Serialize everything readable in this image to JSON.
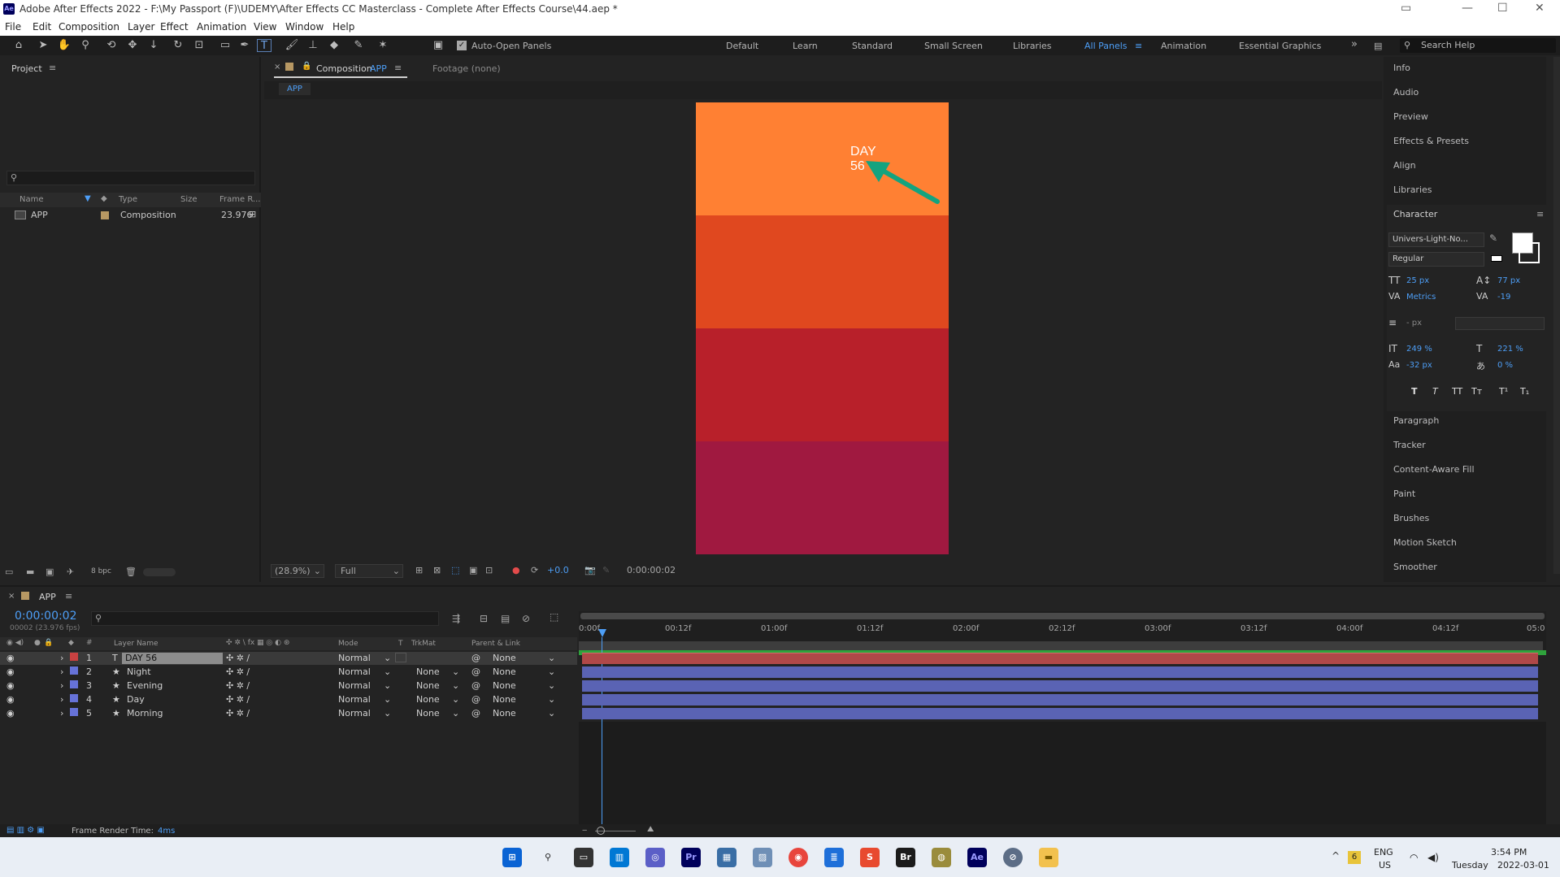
{
  "window": {
    "title": "Adobe After Effects 2022 - F:\\My Passport (F)\\UDEMY\\After Effects CC Masterclass - Complete After Effects Course\\44.aep *",
    "app_badge": "Ae",
    "controls": [
      "restore-panel-icon",
      "minimize-icon",
      "maximize-icon",
      "close-icon"
    ]
  },
  "menu": [
    "File",
    "Edit",
    "Composition",
    "Layer",
    "Effect",
    "Animation",
    "View",
    "Window",
    "Help"
  ],
  "toolbar": {
    "auto_open_panels": "Auto-Open Panels",
    "workspaces": [
      "Default",
      "Learn",
      "Standard",
      "Small Screen",
      "Libraries",
      "All Panels",
      "Animation",
      "Essential Graphics"
    ],
    "active_workspace": "All Panels",
    "more": "»",
    "search_placeholder": "Search Help"
  },
  "project": {
    "title": "Project",
    "columns": {
      "name": "Name",
      "type": "Type",
      "size": "Size",
      "frame_rate": "Frame R..."
    },
    "item": {
      "name": "APP",
      "type": "Composition",
      "frame_rate": "23.976"
    },
    "bpc": "8 bpc"
  },
  "composition": {
    "tab_label": "Composition",
    "tab_name": "APP",
    "footage": "Footage (none)",
    "breadcrumb": "APP",
    "canvas_text_line1": "DAY",
    "canvas_text_line2": "56",
    "zoom": "(28.9%)",
    "resolution": "Full",
    "exposure": "+0.0",
    "timecode": "0:00:00:02",
    "bands": [
      "#ff8033",
      "#e0481f",
      "#b8202a",
      "#a01940"
    ]
  },
  "right_panel": {
    "items_top": [
      "Info",
      "Audio",
      "Preview",
      "Effects & Presets",
      "Align",
      "Libraries"
    ],
    "character": {
      "title": "Character",
      "font": "Univers-Light-No...",
      "style": "Regular",
      "size": "25 px",
      "leading": "77 px",
      "kerning": "Metrics",
      "tracking": "-19",
      "stroke": "- px",
      "vscale": "249 %",
      "hscale": "221 %",
      "baseline": "-32 px",
      "tsume": "0 %",
      "format_buttons": [
        "T",
        "T",
        "TT",
        "Tт",
        "T¹",
        "T₁"
      ]
    },
    "items_bottom": [
      "Paragraph",
      "Tracker",
      "Content-Aware Fill",
      "Paint",
      "Brushes",
      "Motion Sketch",
      "Smoother"
    ]
  },
  "timeline": {
    "tab": "APP",
    "timecode": "0:00:00:02",
    "fps": "00002 (23.976 fps)",
    "columns": {
      "num": "#",
      "layer_name": "Layer Name",
      "mode": "Mode",
      "t": "T",
      "trkmat": "TrkMat",
      "parent": "Parent & Link"
    },
    "layers": [
      {
        "num": "1",
        "name": "DAY 56",
        "type": "T",
        "color": "#c94141",
        "mode": "Normal",
        "trkmat": "",
        "parent": "None"
      },
      {
        "num": "2",
        "name": "Night",
        "type": "★",
        "color": "#6672d8",
        "mode": "Normal",
        "trkmat": "None",
        "parent": "None"
      },
      {
        "num": "3",
        "name": "Evening",
        "type": "★",
        "color": "#6672d8",
        "mode": "Normal",
        "trkmat": "None",
        "parent": "None"
      },
      {
        "num": "4",
        "name": "Day",
        "type": "★",
        "color": "#6672d8",
        "mode": "Normal",
        "trkmat": "None",
        "parent": "None"
      },
      {
        "num": "5",
        "name": "Morning",
        "type": "★",
        "color": "#6672d8",
        "mode": "Normal",
        "trkmat": "None",
        "parent": "None"
      }
    ],
    "ruler": [
      "0:00f",
      "00:12f",
      "01:00f",
      "01:12f",
      "02:00f",
      "02:12f",
      "03:00f",
      "03:12f",
      "04:00f",
      "04:12f",
      "05:0"
    ],
    "render_label": "Frame Render Time:",
    "render_value": "4ms"
  },
  "taskbar": {
    "lang": "ENG",
    "region": "US",
    "time": "3:54 PM",
    "day": "Tuesday",
    "date": "2022-03-01",
    "badge": "6"
  }
}
